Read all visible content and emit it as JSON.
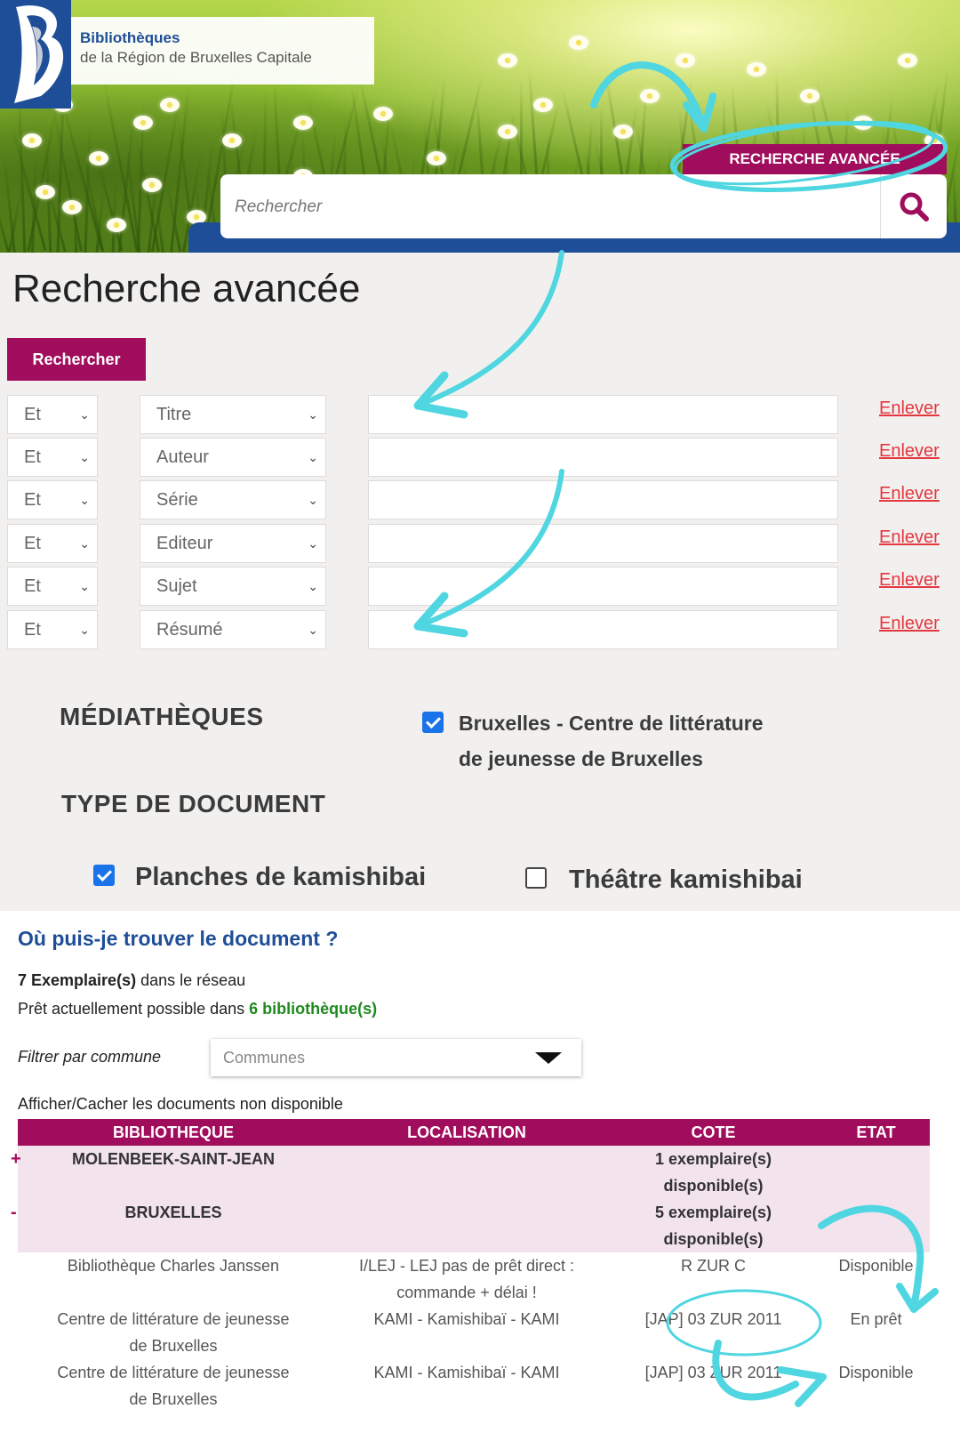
{
  "header": {
    "brand_line1": "Bibliothèques",
    "brand_line2": "de la Région de Bruxelles Capitale",
    "advanced_search_tab": "RECHERCHE AVANCÉE",
    "search_placeholder": "Rechercher",
    "search_icon": "magnifier-icon"
  },
  "advanced": {
    "title": "Recherche avancée",
    "search_button": "Rechercher",
    "rows": [
      {
        "op": "Et",
        "field": "Titre",
        "remove": "Enlever"
      },
      {
        "op": "Et",
        "field": "Auteur",
        "remove": "Enlever"
      },
      {
        "op": "Et",
        "field": "Série",
        "remove": "Enlever"
      },
      {
        "op": "Et",
        "field": "Editeur",
        "remove": "Enlever"
      },
      {
        "op": "Et",
        "field": "Sujet",
        "remove": "Enlever"
      },
      {
        "op": "Et",
        "field": "Résumé",
        "remove": "Enlever"
      }
    ],
    "mediatheques_heading": "MÉDIATHÈQUES",
    "library_option_line1": "Bruxelles - Centre de littérature",
    "library_option_line2": "de jeunesse de Bruxelles",
    "doctype_heading": "TYPE DE DOCUMENT",
    "doctype_options": [
      {
        "label": "Planches de kamishibai",
        "checked": true
      },
      {
        "label": "Théâtre kamishibai",
        "checked": false
      }
    ]
  },
  "where": {
    "title": "Où puis-je trouver le document ?",
    "copies_count": "7 Exemplaire(s)",
    "copies_suffix": " dans le réseau",
    "loans_prefix": "Prêt actuellement possible dans ",
    "loans_count": "6 bibliothèque(s)",
    "filter_label": "Filtrer par commune",
    "filter_placeholder": "Communes",
    "toggle_label": "Afficher/Cacher les documents non disponible",
    "columns": [
      "BIBLIOTHEQUE",
      "LOCALISATION",
      "COTE",
      "ETAT"
    ],
    "groups": [
      {
        "sign": "+",
        "name": "MOLENBEEK-SAINT-JEAN",
        "availability_1": "1 exemplaire(s)",
        "availability_2": "disponible(s)"
      },
      {
        "sign": "-",
        "name": "BRUXELLES",
        "availability_1": "5 exemplaire(s)",
        "availability_2": "disponible(s)"
      }
    ],
    "items": [
      {
        "library": [
          "Bibliothèque Charles Janssen"
        ],
        "location": [
          "I/LEJ - LEJ pas de prêt direct :",
          "commande + délai !"
        ],
        "cote": "R ZUR C",
        "state": "Disponible"
      },
      {
        "library": [
          "Centre de littérature de jeunesse",
          "de Bruxelles"
        ],
        "location": [
          "KAMI - Kamishibaï - KAMI"
        ],
        "cote": "[JAP] 03 ZUR 2011",
        "state": "En prêt"
      },
      {
        "library": [
          "Centre de littérature de jeunesse",
          "de Bruxelles"
        ],
        "location": [
          "KAMI - Kamishibaï - KAMI"
        ],
        "cote": "[JAP] 03 ZUR 2011",
        "state": "Disponible"
      }
    ]
  },
  "colors": {
    "brand_blue": "#1f4e98",
    "accent_magenta": "#a00d5c",
    "remove_red": "#e4373f",
    "annotation_cyan": "#4fd6e0",
    "available_green": "#1e8a1e"
  }
}
